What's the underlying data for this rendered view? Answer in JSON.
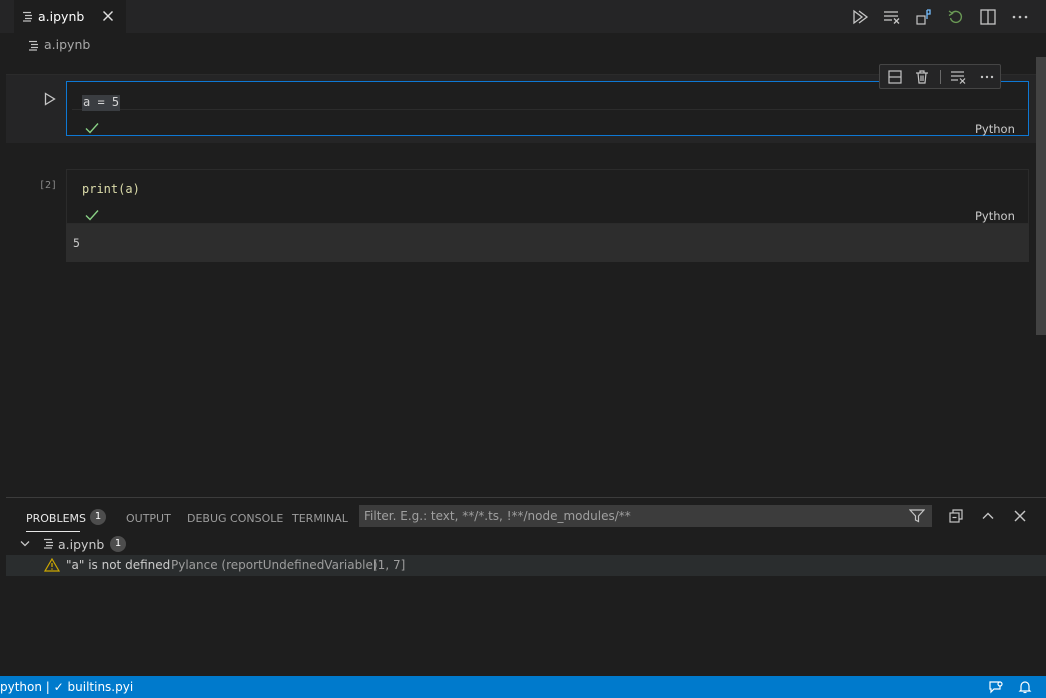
{
  "editor": {
    "tab": {
      "label": "a.ipynb"
    },
    "breadcrumb": {
      "label": "a.ipynb"
    },
    "toolbar_icons": [
      "run-all-icon",
      "clear-outputs-icon",
      "variables-icon",
      "restart-kernel-icon",
      "split-editor-icon",
      "more-actions-icon"
    ]
  },
  "cells": [
    {
      "code": "a = 5",
      "execution_count": "",
      "status": "success",
      "language": "Python",
      "toolbar_icons": [
        "split-cell-icon",
        "delete-cell-icon",
        "clear-output-icon",
        "more-icon"
      ]
    },
    {
      "code": "print(a)",
      "execution_count": "[2]",
      "status": "success",
      "language": "Python",
      "output": "5"
    }
  ],
  "panel": {
    "tabs": {
      "problems": "PROBLEMS",
      "output": "OUTPUT",
      "debug_console": "DEBUG CONSOLE",
      "terminal": "TERMINAL"
    },
    "problems_count": "1",
    "filter_placeholder": "Filter. E.g.: text, **/*.ts, !**/node_modules/**",
    "tree": {
      "file": "a.ipynb",
      "count": "1",
      "problem": {
        "severity": "warning",
        "message": "\"a\" is not defined",
        "source": "Pylance (reportUndefinedVariable)",
        "location": "[1, 7]"
      }
    }
  },
  "statusbar": {
    "left": "python | ✓ builtins.pyi"
  },
  "colors": {
    "accent": "#007acc",
    "focus_border": "#0e78d4",
    "success": "#89d185",
    "warning": "#cca700"
  }
}
